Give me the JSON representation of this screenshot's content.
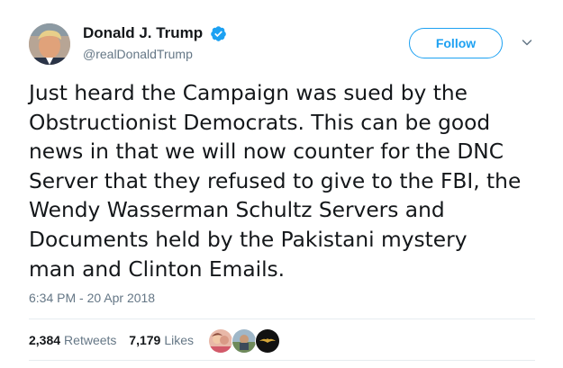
{
  "author": {
    "display_name": "Donald J. Trump",
    "handle": "@realDonaldTrump",
    "verified": true,
    "avatar_icon": "profile-photo"
  },
  "actions": {
    "follow_label": "Follow",
    "menu_icon": "chevron-down-icon"
  },
  "tweet": {
    "lines": [
      "Just heard the Campaign was sued by the",
      "Obstructionist Democrats. This can be good",
      "news in that we will now counter for the DNC",
      "Server that they refused to give to the FBI, the",
      "Wendy Wasserman Schultz Servers and",
      "Documents held by the Pakistani mystery",
      "man and Clinton Emails."
    ],
    "timestamp": "6:34 PM - 20 Apr 2018"
  },
  "stats": {
    "retweets_count": "2,384",
    "retweets_label": "Retweets",
    "likes_count": "7,179",
    "likes_label": "Likes"
  },
  "colors": {
    "accent": "#1da1f2",
    "text": "#14171a",
    "secondary": "#657786",
    "divider": "#e6ecf0"
  }
}
